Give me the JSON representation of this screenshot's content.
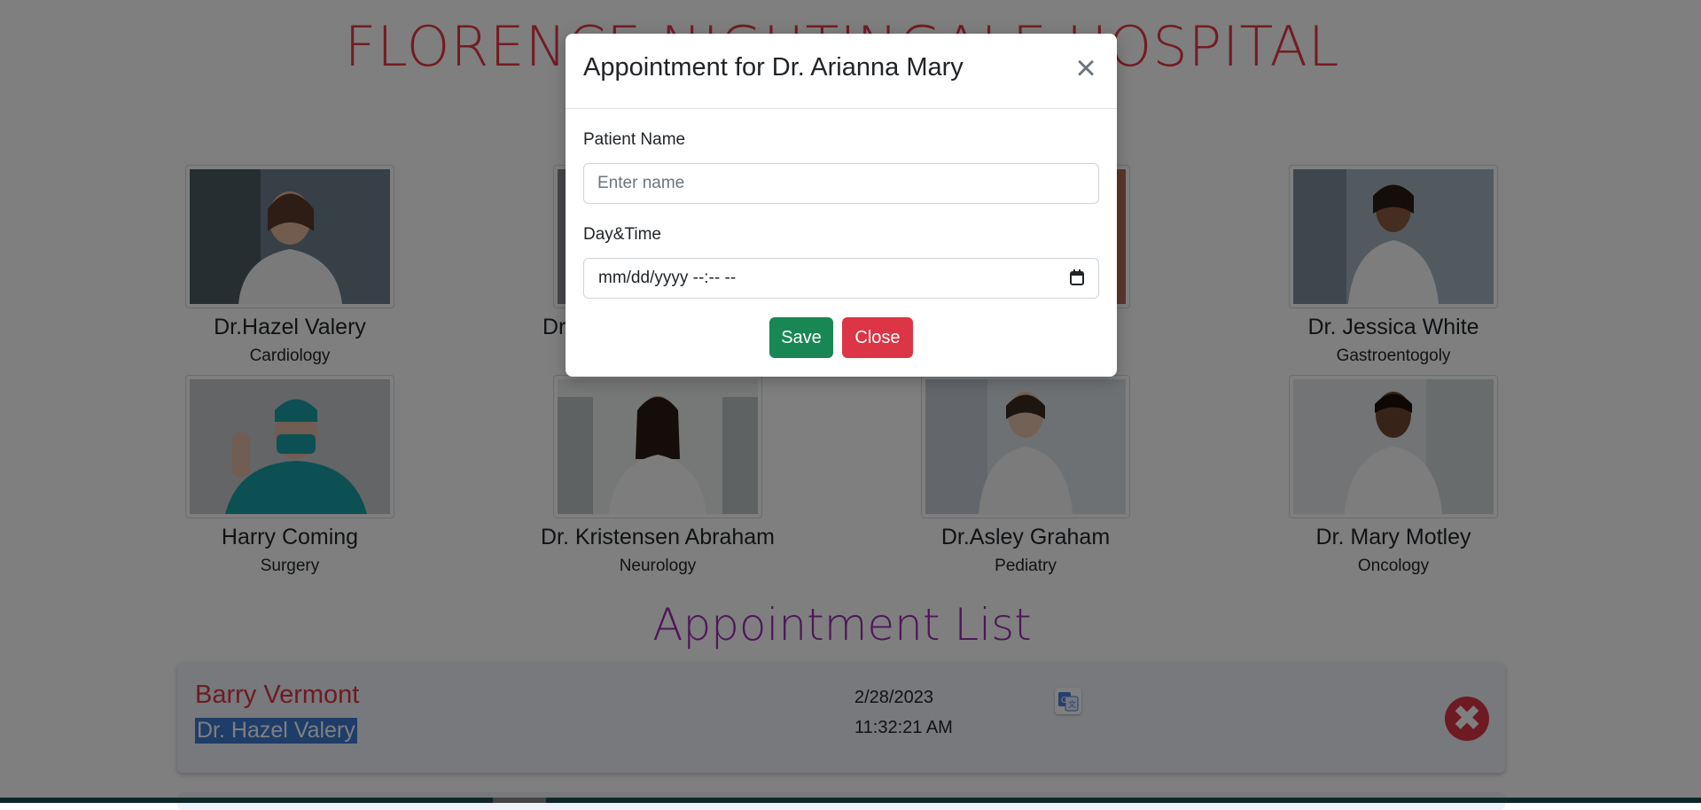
{
  "page": {
    "hospital_title": "FLORENCE NIGHTINGALE HOSPITAL"
  },
  "doctors": [
    {
      "name": "Dr.Hazel Valery",
      "dept": "Cardiology",
      "icon": "doctor-photo"
    },
    {
      "name": "Dr.",
      "dept": "",
      "icon": "doctor-photo"
    },
    {
      "name": "",
      "dept": "",
      "icon": "doctor-photo"
    },
    {
      "name": "Dr. Jessica White",
      "dept": "Gastroentogoly",
      "icon": "doctor-photo"
    },
    {
      "name": "Harry Coming",
      "dept": "Surgery",
      "icon": "doctor-photo"
    },
    {
      "name": "Dr. Kristensen Abraham",
      "dept": "Neurology",
      "icon": "doctor-photo"
    },
    {
      "name": "Dr.Asley Graham",
      "dept": "Pediatry",
      "icon": "doctor-photo"
    },
    {
      "name": "Dr. Mary Motley",
      "dept": "Oncology",
      "icon": "doctor-photo"
    }
  ],
  "appointment_list": {
    "title": "Appointment List",
    "items": [
      {
        "patient": "Barry Vermont",
        "doctor": "Dr. Hazel Valery",
        "date": "2/28/2023",
        "time": "11:32:21 AM"
      }
    ]
  },
  "modal": {
    "title": "Appointment for Dr. Arianna Mary",
    "patient_label": "Patient Name",
    "patient_placeholder": "Enter name",
    "datetime_label": "Day&Time",
    "datetime_value": "mm/dd/yyyy --:-- --",
    "save_label": "Save",
    "close_label": "Close",
    "close_icon": "×"
  },
  "colors": {
    "title_red": "#e63946",
    "list_title_purple": "#9b2fae",
    "save_green": "#198754",
    "close_red": "#dc3545"
  }
}
